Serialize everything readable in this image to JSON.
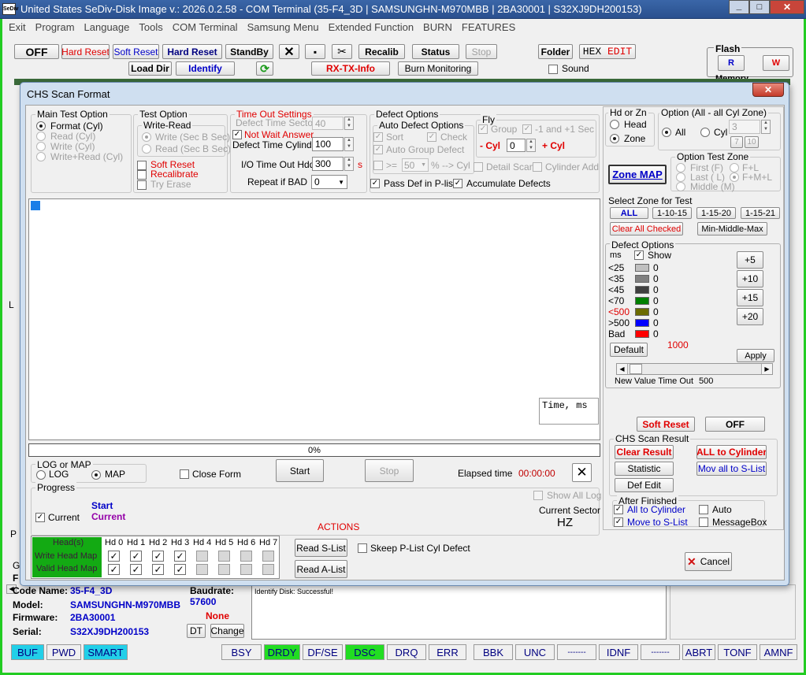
{
  "titlebar": {
    "app_icon": "SeDiv",
    "title": "United States  SeDiv-Disk Image v.: 2026.0.2.58 - COM Terminal  (35-F4_3D | SAMSUNGHN-M970MBB | 2BA30001 | S32XJ9DH200153)"
  },
  "menu": [
    "Exit",
    "Program",
    "Language",
    "Tools",
    "COM Terminal",
    "Samsung Menu",
    "Extended Function",
    "BURN",
    "FEATURES"
  ],
  "toolbar": {
    "off": "OFF",
    "hard_reset_red": "Hard Reset",
    "soft_reset": "Soft Reset",
    "hard_reset": "Hard Reset",
    "standby": "StandBy",
    "recalib": "Recalib",
    "status": "Status",
    "stop": "Stop",
    "folder": "Folder",
    "hex_edit_a": "HEX",
    "hex_edit_b": "EDIT",
    "load_dir": "Load Dir",
    "identify": "Identify",
    "rx_tx": "RX-TX-Info",
    "burn_monitoring": "Burn Monitoring",
    "sound": "Sound",
    "flash": "Flash",
    "memory": "Memory",
    "flash_r": "R",
    "flash_w": "W"
  },
  "dialog": {
    "title": "CHS Scan Format",
    "main_test": {
      "legend": "Main Test Option",
      "options": [
        "Format (Cyl)",
        "Read (Cyl)",
        "Write (Cyl)",
        "Write+Read (Cyl)"
      ]
    },
    "test_option": {
      "legend": "Test Option",
      "write_read": "Write-Read",
      "wr_options": [
        "Write (Sec B Sec)",
        "Read (Sec B Sec)"
      ],
      "soft_reset": "Soft Reset",
      "recalibrate": "Recalibrate",
      "try_erase": "Try Erase"
    },
    "timeout": {
      "legend": "Time Out Settings",
      "defect_sector": "Defect Time Sector",
      "defect_sector_val": "40",
      "not_wait": "Not Wait Answer",
      "defect_cyl": "Defect Time Cylinder",
      "defect_cyl_val": "100",
      "io_timeout": "I/O Time Out Hdd",
      "io_timeout_val": "300",
      "io_unit": "s",
      "repeat": "Repeat if BAD",
      "repeat_val": "0"
    },
    "defect_options": {
      "legend": "Defect Options",
      "auto_legend": "Auto Defect Options",
      "sort": "Sort",
      "check": "Check",
      "auto_group": "Auto Group Defect",
      "ge": ">=",
      "pct_val": "50",
      "pct_text": "% --> Cyl",
      "fly": "Fly",
      "group": "Group",
      "pm1": "-1 and +1 Sec",
      "minus_cyl": "- Cyl",
      "cyl_val": "0",
      "plus_cyl": "+ Cyl",
      "detail_scan": "Detail Scan",
      "cyl_add": "Cylinder Add",
      "pass_def": "Pass Def in P-list",
      "accumulate": "Accumulate Defects"
    },
    "time_ms": "Time, ms",
    "progress_pct": "0%",
    "log_map": {
      "legend": "LOG or MAP",
      "log": "LOG",
      "map": "MAP"
    },
    "close_form": "Close Form",
    "start": "Start",
    "stop": "Stop",
    "elapsed_label": "Elapsed time",
    "elapsed_val": "00:00:00",
    "progress": {
      "legend": "Progress",
      "current": "Current",
      "start": "Start",
      "current_val": "Current"
    },
    "show_all_log": "Show All Log",
    "current_sector_label": "Current Sector",
    "current_sector_val": "HZ",
    "actions": "ACTIONS",
    "head_map": {
      "heads_label": "Head(s)",
      "write_label": "Write Head Map",
      "valid_label": "Valid Head Map",
      "heads": [
        "Hd 0",
        "Hd 1",
        "Hd 2",
        "Hd 3",
        "Hd 4",
        "Hd 5",
        "Hd 6",
        "Hd 7"
      ]
    },
    "read_slist": "Read S-List",
    "read_alist": "Read A-List",
    "skeep": "Skeep P-List Cyl Defect",
    "cancel": "Cancel",
    "hd_zn": {
      "legend": "Hd or Zn",
      "head": "Head",
      "zone": "Zone"
    },
    "opt_all": {
      "legend": "Option (All - all Cyl Zone)",
      "all": "All",
      "cyl": "Cyl",
      "cyl_val": "3",
      "b7": "7",
      "b10": "10"
    },
    "zone_map": "Zone MAP",
    "opt_test_zone": {
      "legend": "Option Test Zone",
      "first": "First (F)",
      "fl": "F+L",
      "last": "Last ( L)",
      "fml": "F+M+L",
      "middle": "Middle (M)"
    },
    "select_zone": {
      "legend": "Select Zone for Test",
      "all": "ALL",
      "b1": "1-10-15",
      "b2": "1-15-20",
      "b3": "1-15-21",
      "clear": "Clear All Checked",
      "mmm": "Min-Middle-Max"
    },
    "defect_right": {
      "legend": "Defect Options",
      "ms": "ms",
      "show": "Show",
      "rows": [
        {
          "label": "<25",
          "val": "0",
          "color": "#c0c0c0"
        },
        {
          "label": "<35",
          "val": "0",
          "color": "#808080"
        },
        {
          "label": "<45",
          "val": "0",
          "color": "#404040"
        },
        {
          "label": "<70",
          "val": "0",
          "color": "#008000"
        },
        {
          "label": "<500",
          "val": "0",
          "color": "#6b6b00"
        },
        {
          "label": ">500",
          "val": "0",
          "color": "#0000ff"
        },
        {
          "label": "Bad",
          "val": "0",
          "color": "#ff0000"
        }
      ],
      "plus5": "+5",
      "plus10": "+10",
      "plus15": "+15",
      "plus20": "+20",
      "default": "Default",
      "val1000": "1000",
      "apply": "Apply",
      "new_val": "New Value Time Out",
      "new_val_num": "500"
    },
    "soft_reset": "Soft Reset",
    "off": "OFF",
    "scan_result": {
      "legend": "CHS Scan Result",
      "clear": "Clear Result",
      "all_cyl": "ALL to Cylinder",
      "statistic": "Statistic",
      "mov_all": "Mov all to S-List",
      "def_edit": "Def Edit"
    },
    "after": {
      "legend": "After Finished",
      "all_cyl": "All to Cylinder",
      "auto": "Auto",
      "move_s": "Move to S-List",
      "msgbox": "MessageBox"
    }
  },
  "bottom": {
    "code_name_l": "Code Name:",
    "code_name": "35-F4_3D",
    "model_l": "Model:",
    "model": "SAMSUNGHN-M970MBB",
    "firmware_l": "Firmware:",
    "firmware": "2BA30001",
    "serial_l": "Serial:",
    "serial": "S32XJ9DH200153",
    "baudrate_l": "Baudrate:",
    "baudrate": "57600",
    "none": "None",
    "dt": "DT",
    "change": "Change",
    "log": "Identify Disk: Successful!"
  },
  "status": [
    "BUF",
    "PWD",
    "SMART",
    "BSY",
    "DRDY",
    "DF/SE",
    "DSC",
    "DRQ",
    "ERR",
    "BBK",
    "UNC",
    "-------",
    "IDNF",
    "-------",
    "ABRT",
    "TONF",
    "AMNF"
  ]
}
